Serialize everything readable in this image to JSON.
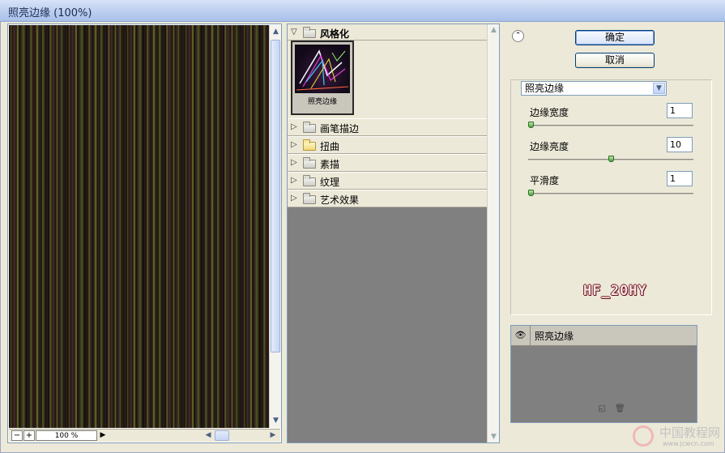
{
  "window": {
    "title": "照亮边缘 (100%)"
  },
  "preview": {
    "zoom": "100 %",
    "zoom_minus": "−",
    "zoom_plus": "+"
  },
  "gallery": {
    "open_category": "风格化",
    "selected_filter": "照亮边缘",
    "categories": [
      "画笔描边",
      "扭曲",
      "素描",
      "纹理",
      "艺术效果"
    ]
  },
  "buttons": {
    "ok": "确定",
    "cancel": "取消"
  },
  "filter_select": {
    "value": "照亮边缘"
  },
  "params": [
    {
      "label": "边缘宽度",
      "value": "1",
      "level": 0.0
    },
    {
      "label": "边缘亮度",
      "value": "10",
      "level": 0.5
    },
    {
      "label": "平滑度",
      "value": "1",
      "level": 0.0
    }
  ],
  "logo_text": "HF_20HY",
  "layers": [
    {
      "name": "照亮边缘",
      "visible": true
    }
  ],
  "watermark": {
    "text": "中国教程网",
    "sub": "www.jcwcn.com"
  },
  "colors": {
    "accent": "#003c74",
    "logo": "#6e0c18"
  }
}
